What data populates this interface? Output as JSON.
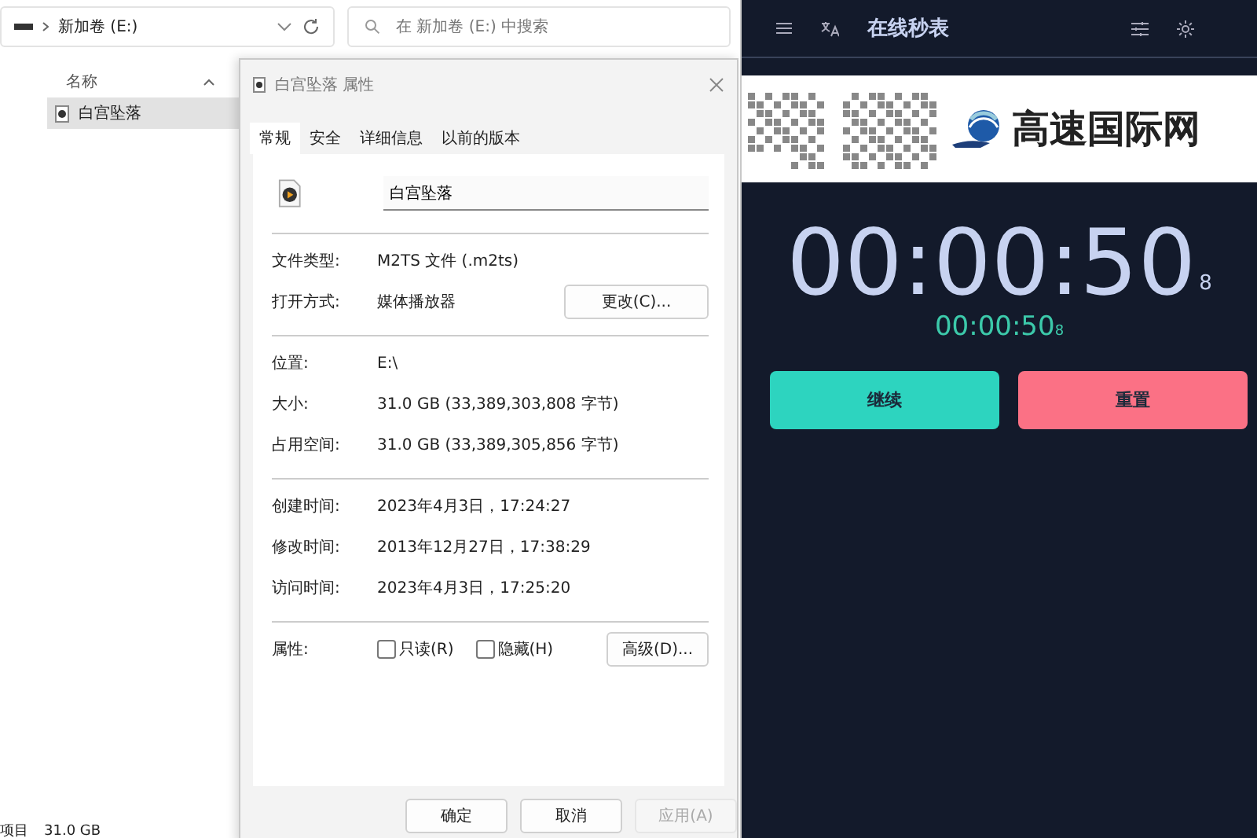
{
  "explorer": {
    "breadcrumb": "新加卷 (E:)",
    "search": {
      "placeholder": "在 新加卷 (E:) 中搜索"
    },
    "column_header": "名称",
    "files": [
      {
        "name": "白宫坠落",
        "selected": true
      }
    ],
    "status_bar": [
      "项目",
      "31.0 GB"
    ]
  },
  "dialog": {
    "title": "白宫坠落 属性",
    "tabs": [
      {
        "label": "常规",
        "selected": true
      },
      {
        "label": "安全",
        "selected": false
      },
      {
        "label": "详细信息",
        "selected": false
      },
      {
        "label": "以前的版本",
        "selected": false
      }
    ],
    "file_name": "白宫坠落",
    "sections": [
      [
        {
          "label": "文件类型:",
          "value": "M2TS 文件 (.m2ts)"
        },
        {
          "label": "打开方式:",
          "value": "媒体播放器",
          "button": "更改(C)..."
        }
      ],
      [
        {
          "label": "位置:",
          "value": "E:\\"
        },
        {
          "label": "大小:",
          "value": "31.0 GB (33,389,303,808 字节)"
        },
        {
          "label": "占用空间:",
          "value": "31.0 GB (33,389,305,856 字节)"
        }
      ],
      [
        {
          "label": "创建时间:",
          "value": "2023年4月3日，17:24:27"
        },
        {
          "label": "修改时间:",
          "value": "2013年12月27日，17:38:29"
        },
        {
          "label": "访问时间:",
          "value": "2023年4月3日，17:25:20"
        }
      ]
    ],
    "attributes": {
      "label": "属性:",
      "checkboxes": [
        {
          "label": "只读(R)",
          "checked": false
        },
        {
          "label": "隐藏(H)",
          "checked": false
        }
      ],
      "button": "高级(D)..."
    },
    "buttons": [
      {
        "label": "确定",
        "disabled": false
      },
      {
        "label": "取消",
        "disabled": false
      },
      {
        "label": "应用(A)",
        "disabled": true
      }
    ]
  },
  "stopwatch": {
    "title": "在线秒表",
    "banner": "高速国际网",
    "time": "00:00:50",
    "time_fraction": "8",
    "lap": "00:00:50",
    "lap_fraction": "8",
    "buttons": [
      {
        "label": "继续",
        "kind": "continue"
      },
      {
        "label": "重置",
        "kind": "reset"
      }
    ]
  }
}
